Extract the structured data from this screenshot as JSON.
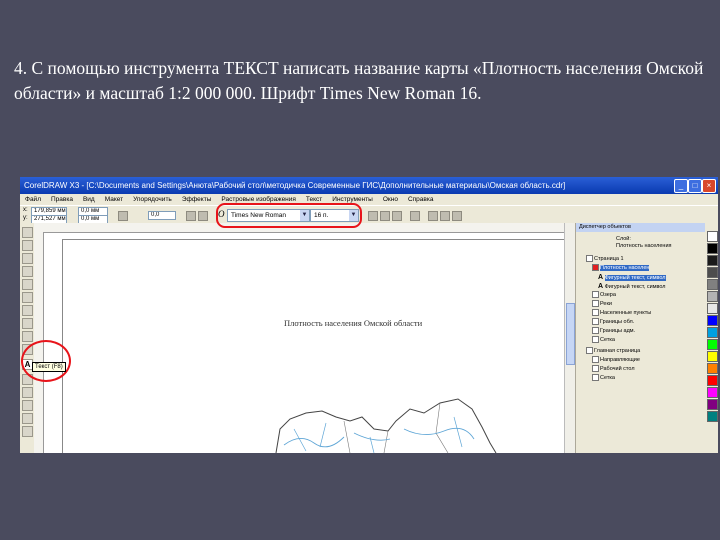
{
  "instruction": "4. С помощью инструмента ТЕКСТ написать название карты «Плотность населения Омской области» и масштаб 1:2 000 000. Шрифт Times New Roman 16.",
  "window": {
    "title": "CorelDRAW X3 - [C:\\Documents and Settings\\Анюта\\Рабочий стол\\методичка Современные ГИС\\Дополнительные материалы\\Омская область.cdr]"
  },
  "menu": [
    "Файл",
    "Правка",
    "Вид",
    "Макет",
    "Упорядочить",
    "Эффекты",
    "Растровые изображения",
    "Текст",
    "Инструменты",
    "Окно",
    "Справка"
  ],
  "propbar": {
    "x_label": "x:",
    "x_value": "179,859 мм",
    "y_label": "y:",
    "y_value": "271,527 мм",
    "w_value": "0,0 мм",
    "h_value": "0,0 мм",
    "angle_value": "0,0",
    "font_name": "Times New Roman",
    "font_size": "16 п."
  },
  "canvas": {
    "map_title": "Плотность населения Омской области"
  },
  "tooltip": "Текст (F8)",
  "docker": {
    "title": "Диспетчер объектов",
    "sheet_label": "Слой:",
    "sheet_value": "Плотность населения",
    "page1": "Страница 1",
    "page1_items": [
      "Плотность населен",
      "Фигурный текст, символ",
      "Фигурный текст, символ",
      "Озера",
      "Реки",
      "Населенные пункты",
      "Границы обл.",
      "Границы адм.",
      "Сетка"
    ],
    "master": "Главная страница",
    "master_items": [
      "Направляющие",
      "Рабочий стол",
      "Сетка"
    ]
  },
  "palette_colors": [
    "#ffffff",
    "#000000",
    "#1a1a1a",
    "#4d4d4d",
    "#808080",
    "#b3b3b3",
    "#e6e6e6",
    "#0000ff",
    "#00a0e0",
    "#00ff00",
    "#ffff00",
    "#ff8000",
    "#ff0000",
    "#ff00ff",
    "#800080",
    "#008080"
  ],
  "accent": {
    "highlight": "#e8141a",
    "titlebar": "#0a3ab0"
  }
}
